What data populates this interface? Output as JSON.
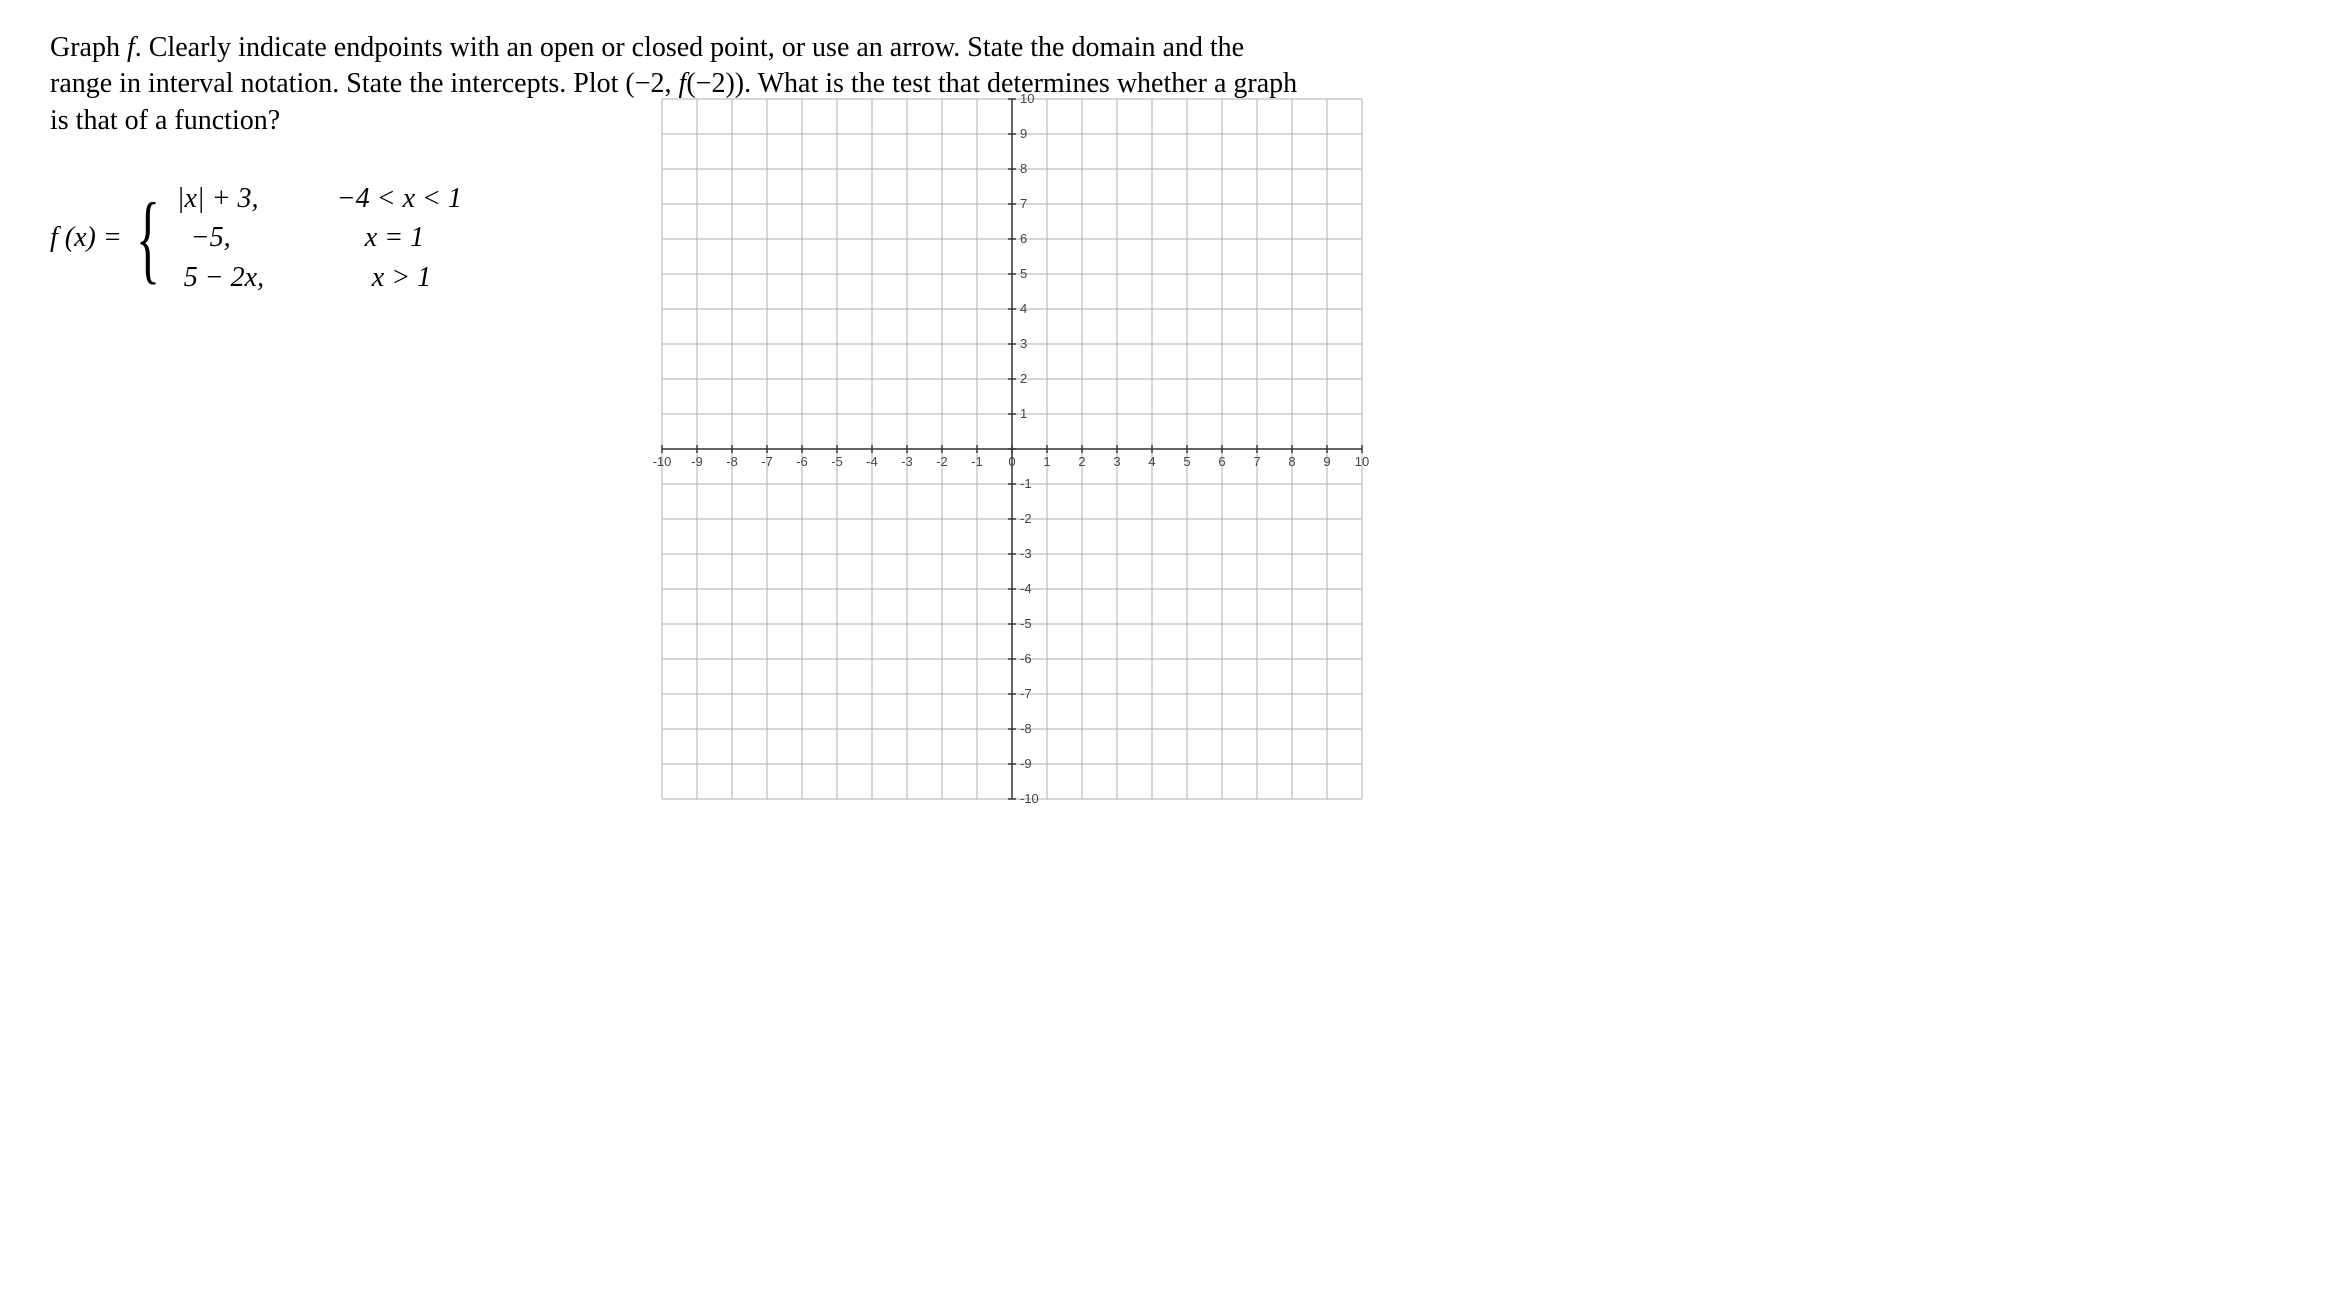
{
  "prompt": {
    "line1": "Graph f.  Clearly indicate endpoints with an open or closed point, or use an arrow.  State the domain and the range in interval notation.  State the intercepts.  Plot (−2, f(−2)).  What is the test that determines whether a graph is that of a function?"
  },
  "function": {
    "lhs": "f (x) = ",
    "case1_expr": "|x| + 3,",
    "case1_cond": "−4 < x < 1",
    "case2_expr": "−5,",
    "case2_cond": "x = 1",
    "case3_expr": "5 − 2x,",
    "case3_cond": "x > 1"
  },
  "chart_data": {
    "type": "grid",
    "xmin": -10,
    "xmax": 10,
    "ymin": -10,
    "ymax": 10,
    "xstep": 1,
    "ystep": 1,
    "xlabels": [
      "-10",
      "-9",
      "-8",
      "-7",
      "-6",
      "-5",
      "-4",
      "-3",
      "-2",
      "-1",
      "0",
      "1",
      "2",
      "3",
      "4",
      "5",
      "6",
      "7",
      "8",
      "9",
      "10"
    ],
    "ylabels_pos": [
      "1",
      "2",
      "3",
      "4",
      "5",
      "6",
      "7",
      "8",
      "9",
      "10"
    ],
    "ylabels_neg": [
      "-1",
      "-2",
      "-3",
      "-4",
      "-5",
      "-6",
      "-7",
      "-8",
      "-9",
      "-10"
    ]
  }
}
